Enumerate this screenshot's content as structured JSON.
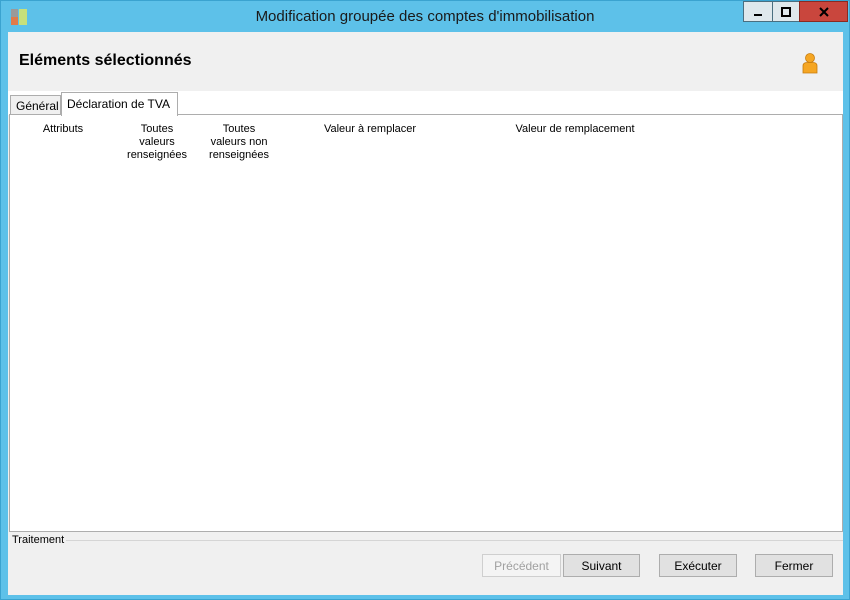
{
  "window": {
    "title": "Modification groupée des comptes d'immobilisation",
    "accent_color": "#5dc1e9",
    "icons": [
      "app-icon",
      "minimize-icon",
      "maximize-icon",
      "close-icon"
    ]
  },
  "header": {
    "title": "Eléments sélectionnés",
    "icon": "user-icon"
  },
  "tabs": [
    {
      "label": "Général",
      "active": false
    },
    {
      "label": "Déclaration de TVA",
      "active": true
    }
  ],
  "columns": [
    {
      "label": "Attributs"
    },
    {
      "label": "Toutes\nvaleurs\nrenseignées"
    },
    {
      "label": "Toutes\nvaleurs non\nrenseignées"
    },
    {
      "label": "Valeur à remplacer"
    },
    {
      "label": "Valeur de remplacement"
    }
  ],
  "group": {
    "label": "Traitement"
  },
  "buttons": {
    "previous": {
      "label": "Précédent",
      "enabled": false
    },
    "next": {
      "label": "Suivant",
      "enabled": true
    },
    "execute": {
      "label": "Exécuter",
      "enabled": true
    },
    "close": {
      "label": "Fermer",
      "enabled": true
    }
  }
}
